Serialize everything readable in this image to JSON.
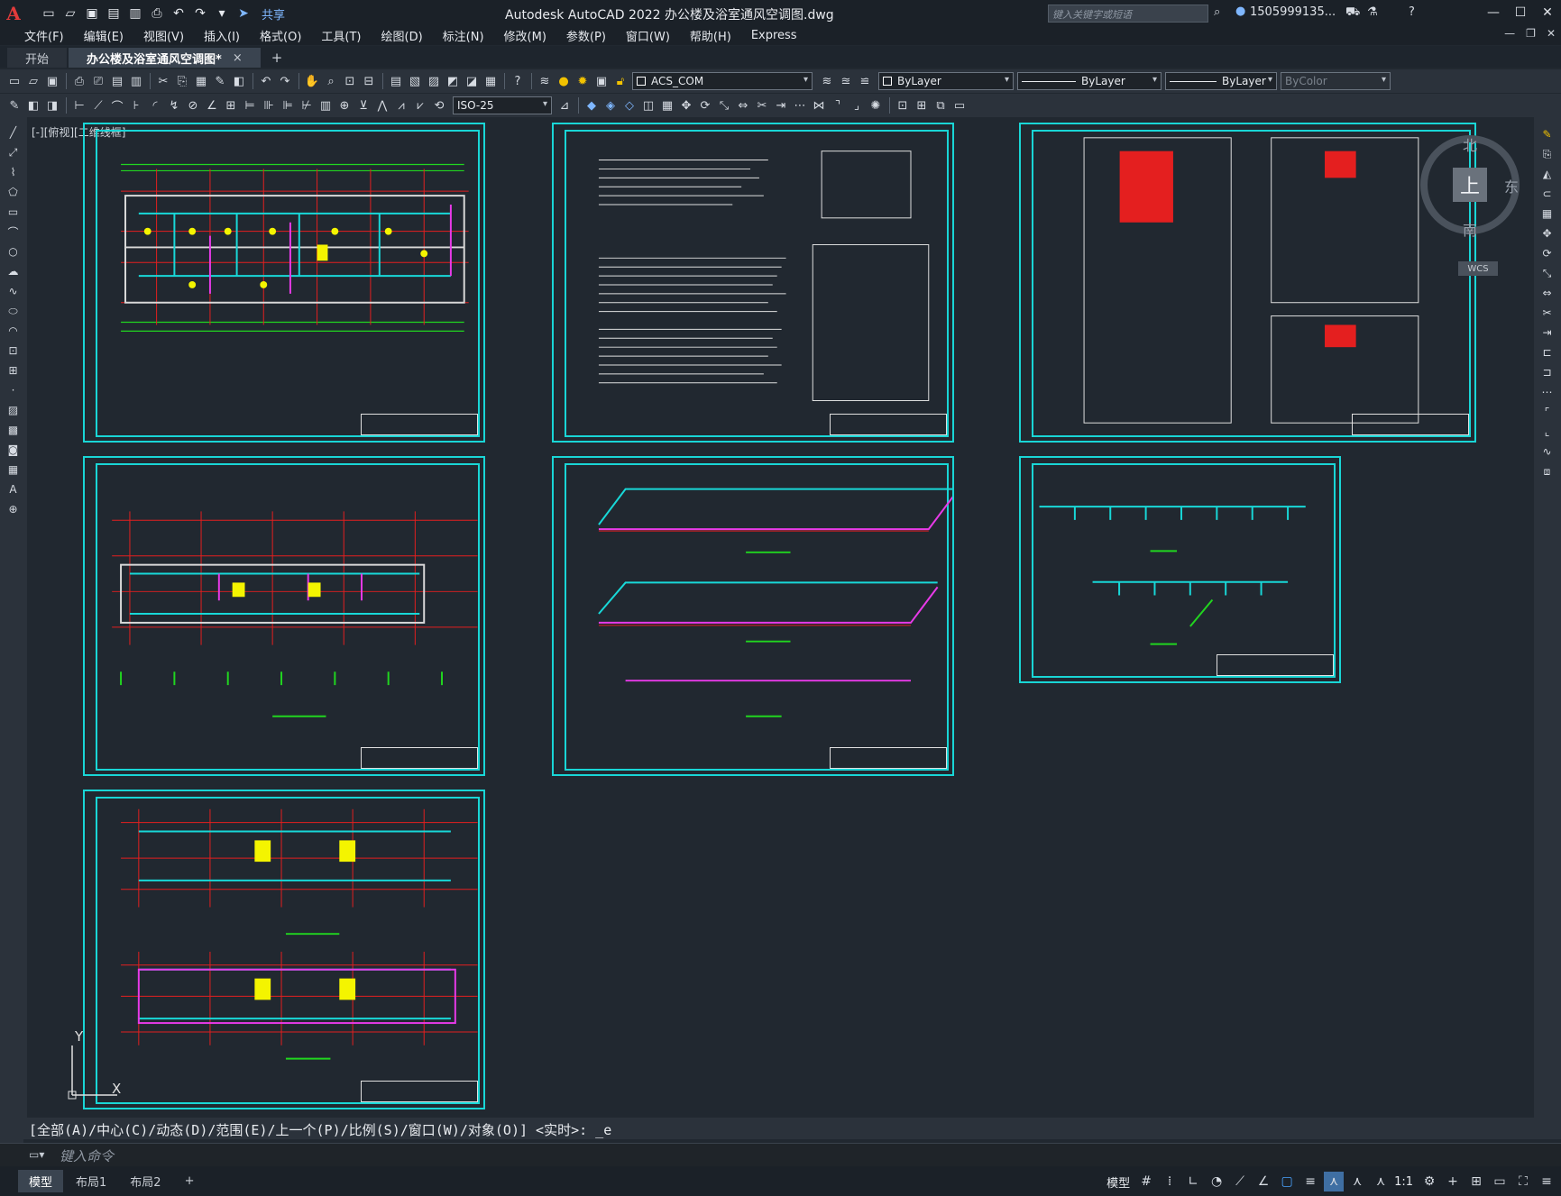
{
  "app": {
    "logo": "A",
    "title": "Autodesk AutoCAD 2022    办公楼及浴室通风空调图.dwg",
    "share": "共享",
    "search_placeholder": "键入关键字或短语",
    "user": "1505999135...",
    "window_controls": [
      "—",
      "☐",
      "✕"
    ]
  },
  "menu": [
    "文件(F)",
    "编辑(E)",
    "视图(V)",
    "插入(I)",
    "格式(O)",
    "工具(T)",
    "绘图(D)",
    "标注(N)",
    "修改(M)",
    "参数(P)",
    "窗口(W)",
    "帮助(H)",
    "Express"
  ],
  "tabs": [
    {
      "label": "开始"
    },
    {
      "label": "办公楼及浴室通风空调图*",
      "close": "×"
    }
  ],
  "toolbar1": {
    "layer": "ACS_COM",
    "color": "ByLayer",
    "linetype": "ByLayer",
    "lineweight": "ByLayer",
    "plotstyle": "ByColor"
  },
  "toolbar2": {
    "dimstyle": "ISO-25"
  },
  "viewport": {
    "label": "[-][俯视][二维线框]"
  },
  "viewcube": {
    "north": "北",
    "south": "南",
    "east": "东",
    "face": "上",
    "wcs": "WCS"
  },
  "ucs": {
    "x": "X",
    "y": "Y"
  },
  "command": {
    "history": "[全部(A)/中心(C)/动态(D)/范围(E)/上一个(P)/比例(S)/窗口(W)/对象(O)] <实时>: _e",
    "placeholder": "键入命令"
  },
  "layout_tabs": [
    "模型",
    "布局1",
    "布局2"
  ],
  "status": {
    "model": "模型",
    "scale": "1:1"
  },
  "colors": {
    "sheet_border": "#19d6d6",
    "background": "#212830"
  }
}
